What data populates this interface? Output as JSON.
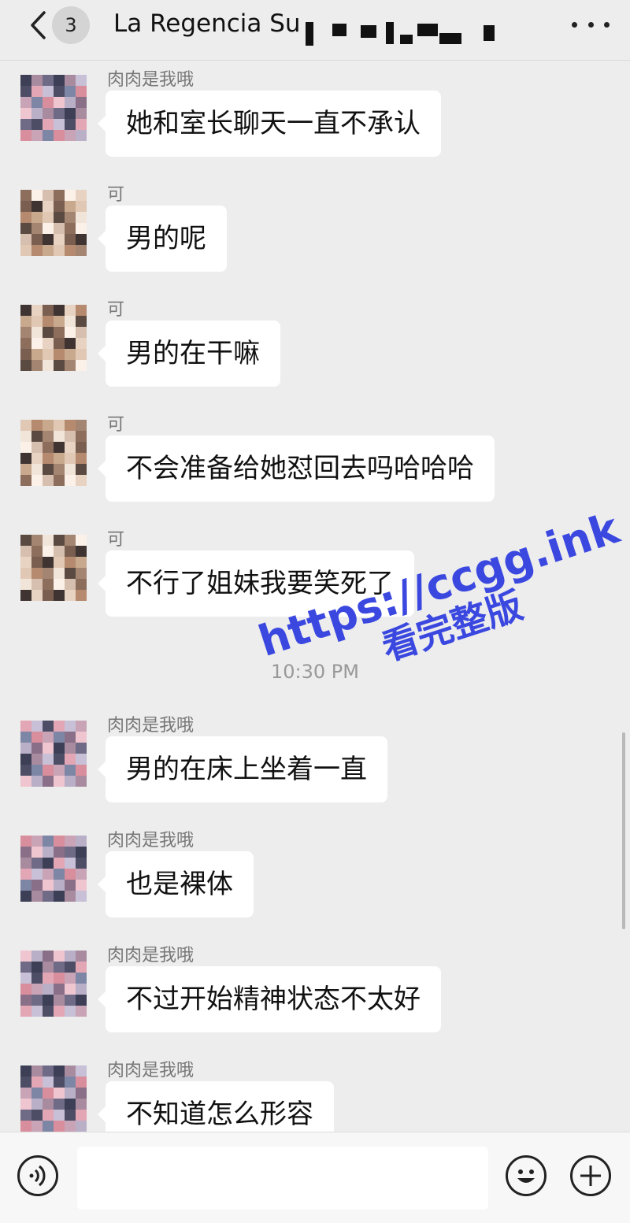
{
  "header": {
    "unread_count": "3",
    "title": "La Regencia Su"
  },
  "messages": [
    {
      "sender": "肉肉是我哦",
      "text": "她和室长聊天一直不承认",
      "avatar": "avatar-1"
    },
    {
      "sender": "可",
      "text": "男的呢",
      "avatar": "avatar-2"
    },
    {
      "sender": "可",
      "text": "男的在干嘛",
      "avatar": "avatar-2"
    },
    {
      "sender": "可",
      "text": "不会准备给她怼回去吗哈哈哈",
      "avatar": "avatar-2"
    },
    {
      "sender": "可",
      "text": "不行了姐妹我要笑死了",
      "avatar": "avatar-2"
    },
    {
      "sender": "肉肉是我哦",
      "text": "男的在床上坐着一直",
      "avatar": "avatar-1"
    },
    {
      "sender": "肉肉是我哦",
      "text": "也是裸体",
      "avatar": "avatar-1"
    },
    {
      "sender": "肉肉是我哦",
      "text": "不过开始精神状态不太好",
      "avatar": "avatar-1"
    },
    {
      "sender": "肉肉是我哦",
      "text": "不知道怎么形容",
      "avatar": "avatar-1"
    }
  ],
  "timestamp": "10:30 PM",
  "watermark": {
    "url": "https://ccgg.ink",
    "subtitle": "看完整版",
    "color": "#3b48e0"
  },
  "input_bar": {
    "value": "",
    "icons": [
      "voice-icon",
      "emoji-icon",
      "plus-icon"
    ]
  },
  "colors": {
    "background": "#ededed",
    "bubble": "#ffffff",
    "sender_name": "#777777"
  }
}
